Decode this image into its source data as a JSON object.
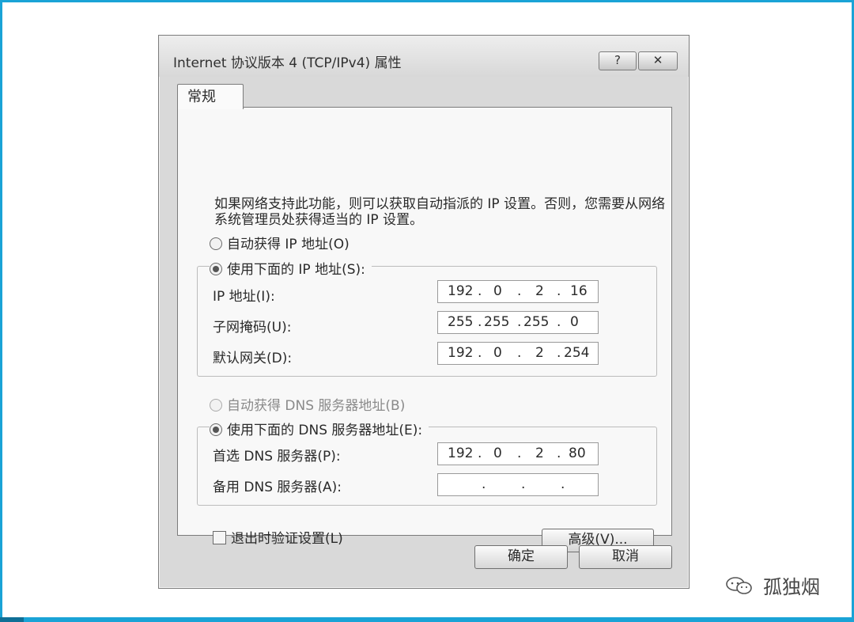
{
  "window": {
    "title": "Internet 协议版本 4 (TCP/IPv4) 属性",
    "help_label": "?",
    "close_label": "✕"
  },
  "tab": {
    "label": "常规"
  },
  "description": "如果网络支持此功能，则可以获取自动指派的 IP 设置。否则，您需要从网络系统管理员处获得适当的 IP 设置。",
  "ip_section": {
    "auto_label": "自动获得 IP 地址(O)",
    "manual_label": "使用下面的 IP 地址(S):",
    "selected": "manual",
    "fields": [
      {
        "label": "IP 地址(I):",
        "octets": [
          "192",
          "0",
          "2",
          "16"
        ]
      },
      {
        "label": "子网掩码(U):",
        "octets": [
          "255",
          "255",
          "255",
          "0"
        ]
      },
      {
        "label": "默认网关(D):",
        "octets": [
          "192",
          "0",
          "2",
          "254"
        ]
      }
    ]
  },
  "dns_section": {
    "auto_label": "自动获得 DNS 服务器地址(B)",
    "manual_label": "使用下面的 DNS 服务器地址(E):",
    "selected": "manual",
    "fields": [
      {
        "label": "首选 DNS 服务器(P):",
        "octets": [
          "192",
          "0",
          "2",
          "80"
        ]
      },
      {
        "label": "备用 DNS 服务器(A):",
        "octets": [
          "",
          "",
          "",
          ""
        ]
      }
    ]
  },
  "validate_on_exit": {
    "label": "退出时验证设置(L)",
    "checked": false
  },
  "buttons": {
    "advanced": "高级(V)...",
    "ok": "确定",
    "cancel": "取消"
  },
  "watermark": "孤独烟",
  "colors": {
    "frame_accent": "#1aa3d6"
  }
}
